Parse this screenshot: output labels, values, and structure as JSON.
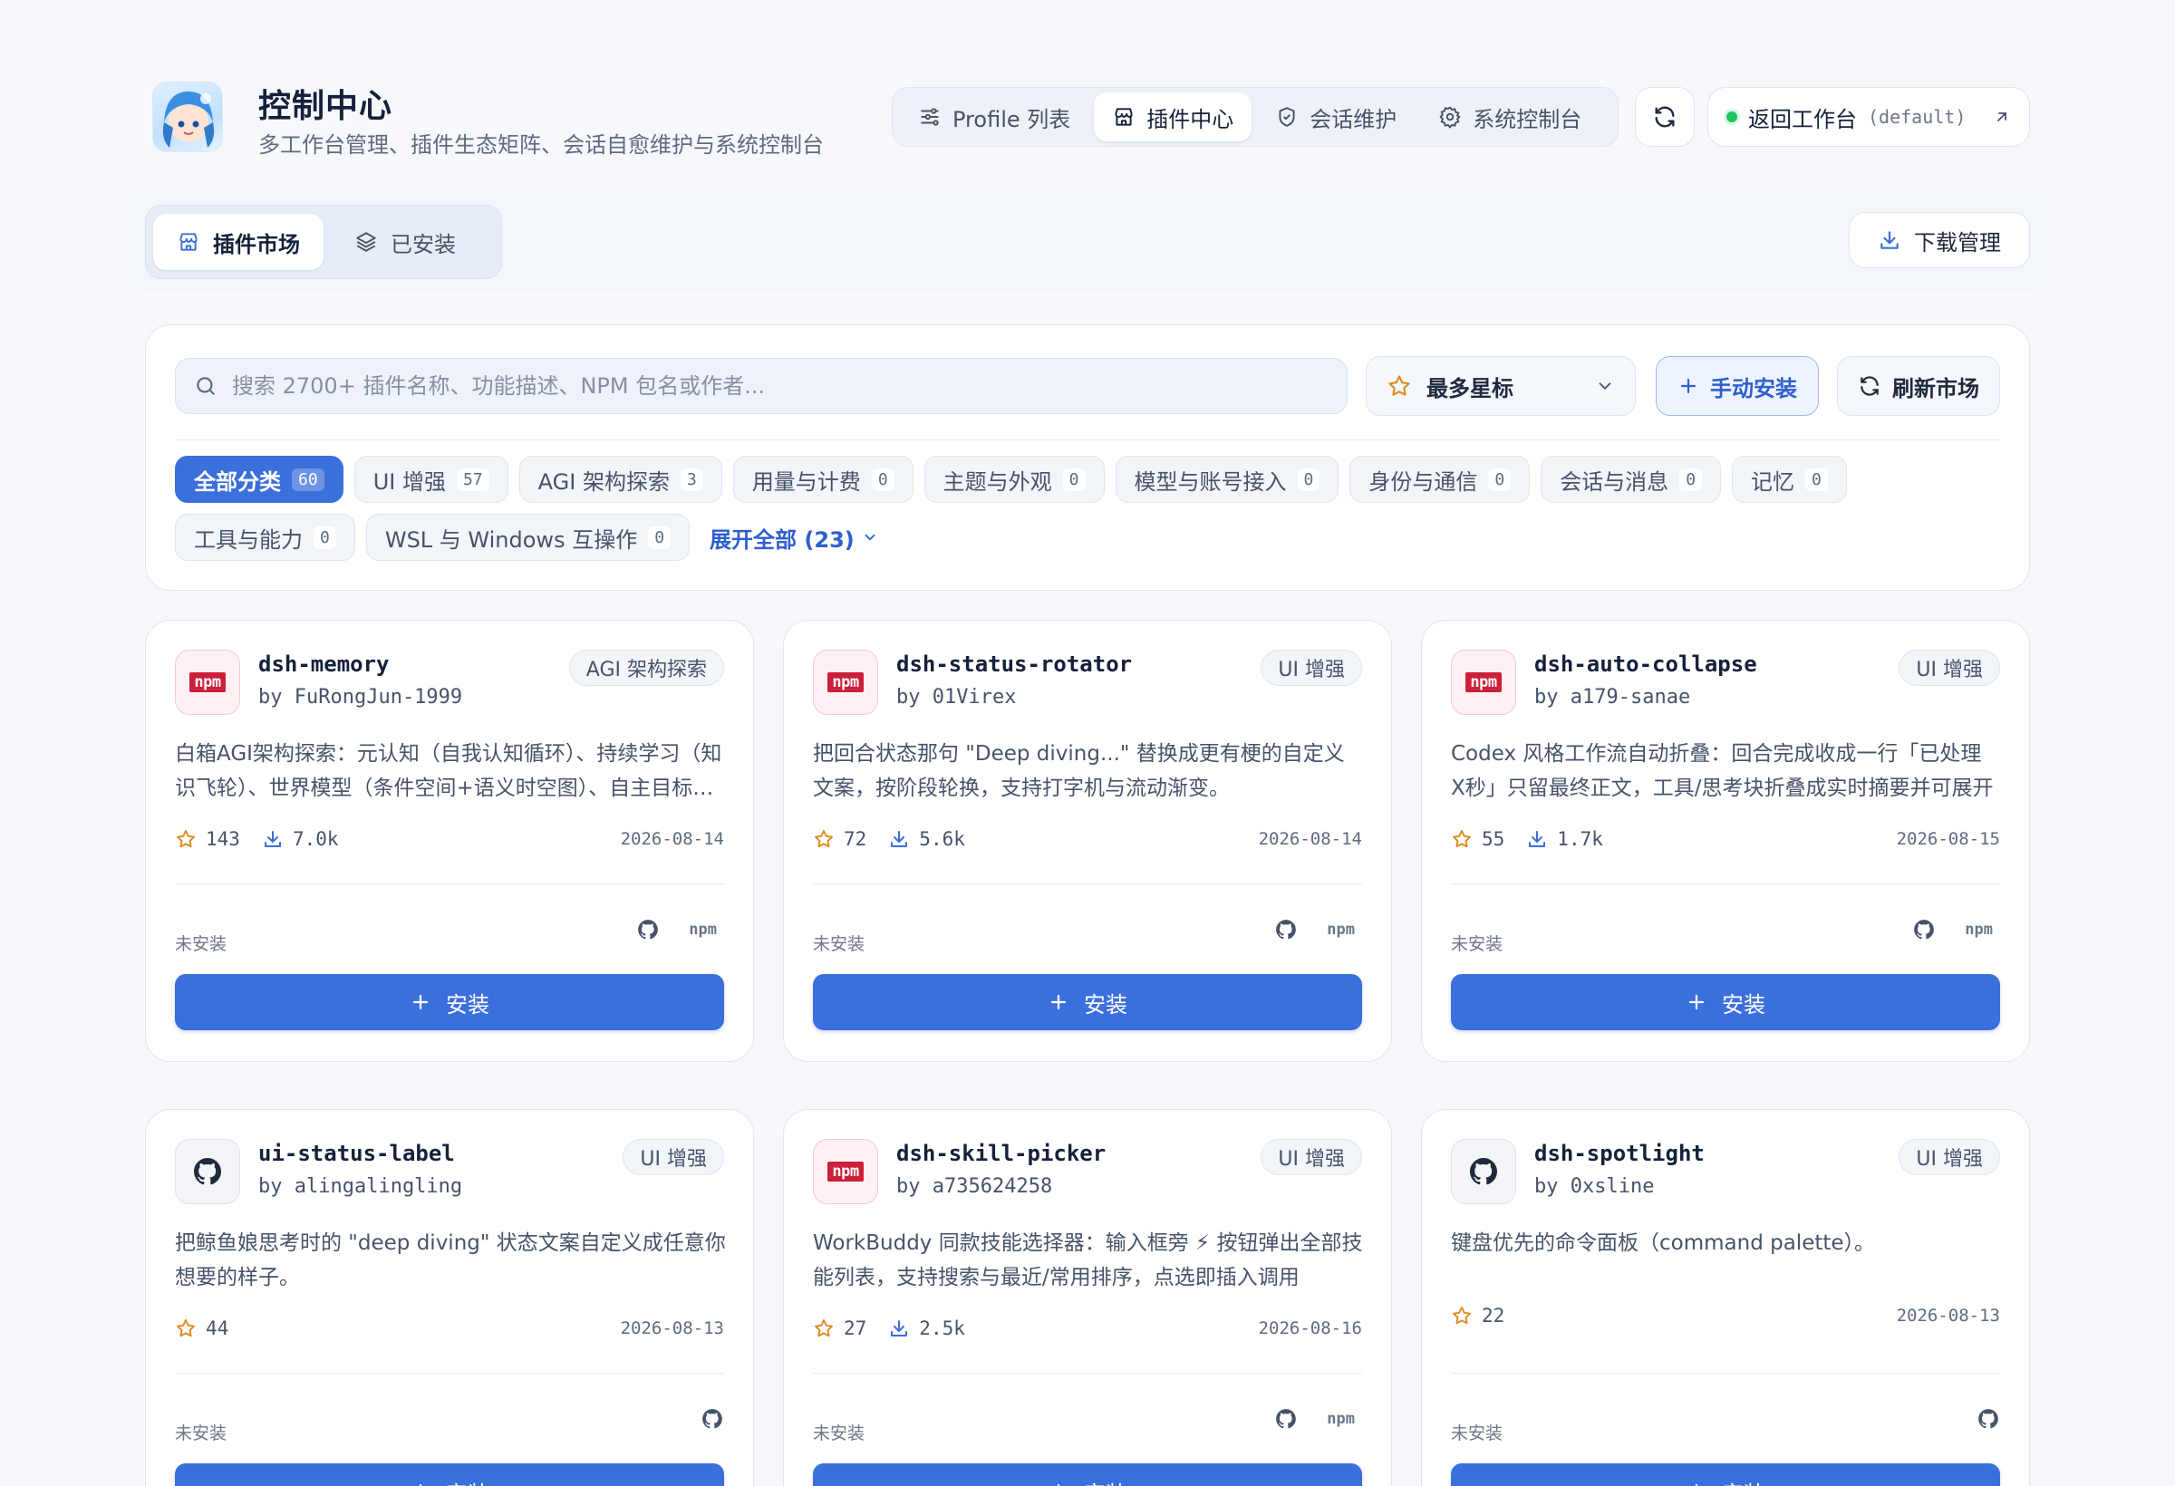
{
  "header": {
    "title": "控制中心",
    "subtitle": "多工作台管理、插件生态矩阵、会话自愈维护与系统控制台",
    "nav": [
      {
        "label": "Profile 列表",
        "icon": "sliders-icon"
      },
      {
        "label": "插件中心",
        "icon": "store-icon"
      },
      {
        "label": "会话维护",
        "icon": "shield-icon"
      },
      {
        "label": "系统控制台",
        "icon": "gear-icon"
      }
    ],
    "back_label": "返回工作台",
    "back_workspace": "(default)"
  },
  "tabs": {
    "market": "插件市场",
    "installed": "已安装",
    "download_manager": "下载管理"
  },
  "filters": {
    "search_placeholder": "搜索 2700+ 插件名称、功能描述、NPM 包名或作者...",
    "sort_value": "最多星标",
    "manual_install": "手动安装",
    "refresh_market": "刷新市场",
    "categories": [
      {
        "label": "全部分类",
        "count": "60"
      },
      {
        "label": "UI 增强",
        "count": "57"
      },
      {
        "label": "AGI 架构探索",
        "count": "3"
      },
      {
        "label": "用量与计费",
        "count": "0"
      },
      {
        "label": "主题与外观",
        "count": "0"
      },
      {
        "label": "模型与账号接入",
        "count": "0"
      },
      {
        "label": "身份与通信",
        "count": "0"
      },
      {
        "label": "会话与消息",
        "count": "0"
      },
      {
        "label": "记忆",
        "count": "0"
      },
      {
        "label": "工具与能力",
        "count": "0"
      },
      {
        "label": "WSL 与 Windows 互操作",
        "count": "0"
      }
    ],
    "expand_all": "展开全部 (23)"
  },
  "plugins": [
    {
      "name": "dsh-memory",
      "author": "by FuRongJun-1999",
      "tag": "AGI 架构探索",
      "logo": "npm",
      "desc": "白箱AGI架构探索：元认知（自我认知循环）、持续学习（知识飞轮）、世界模型（条件空间+语义时空图）、自主目标生成等",
      "stars": "143",
      "downloads": "7.0k",
      "date": "2026-08-14",
      "status": "未安装",
      "links": [
        "github",
        "npm"
      ],
      "install": "安装"
    },
    {
      "name": "dsh-status-rotator",
      "author": "by 01Virex",
      "tag": "UI 增强",
      "logo": "npm",
      "desc": "把回合状态那句 \"Deep diving...\" 替换成更有梗的自定义文案，按阶段轮换，支持打字机与流动渐变。",
      "stars": "72",
      "downloads": "5.6k",
      "date": "2026-08-14",
      "status": "未安装",
      "links": [
        "github",
        "npm"
      ],
      "install": "安装"
    },
    {
      "name": "dsh-auto-collapse",
      "author": "by a179-sanae",
      "tag": "UI 增强",
      "logo": "npm",
      "desc": "Codex 风格工作流自动折叠：回合完成收成一行「已处理 X秒」只留最终正文，工具/思考块折叠成实时摘要并可展开",
      "stars": "55",
      "downloads": "1.7k",
      "date": "2026-08-15",
      "status": "未安装",
      "links": [
        "github",
        "npm"
      ],
      "install": "安装"
    },
    {
      "name": "ui-status-label",
      "author": "by alingalingling",
      "tag": "UI 增强",
      "logo": "github",
      "desc": "把鲸鱼娘思考时的 \"deep diving\" 状态文案自定义成任意你想要的样子。",
      "stars": "44",
      "downloads": "",
      "date": "2026-08-13",
      "status": "未安装",
      "links": [
        "github"
      ],
      "install": "安装"
    },
    {
      "name": "dsh-skill-picker",
      "author": "by a735624258",
      "tag": "UI 增强",
      "logo": "npm",
      "desc": "WorkBuddy 同款技能选择器：输入框旁 ⚡ 按钮弹出全部技能列表，支持搜索与最近/常用排序，点选即插入调用",
      "stars": "27",
      "downloads": "2.5k",
      "date": "2026-08-16",
      "status": "未安装",
      "links": [
        "github",
        "npm"
      ],
      "install": "安装"
    },
    {
      "name": "dsh-spotlight",
      "author": "by 0xsline",
      "tag": "UI 增强",
      "logo": "github",
      "desc": "键盘优先的命令面板（command palette）。",
      "stars": "22",
      "downloads": "",
      "date": "2026-08-13",
      "status": "未安装",
      "links": [
        "github"
      ],
      "install": "安装"
    }
  ],
  "colors": {
    "primary": "#3b6fdc",
    "star": "#e08a1e",
    "npm": "#cb1f3a",
    "online": "#22c55e"
  }
}
